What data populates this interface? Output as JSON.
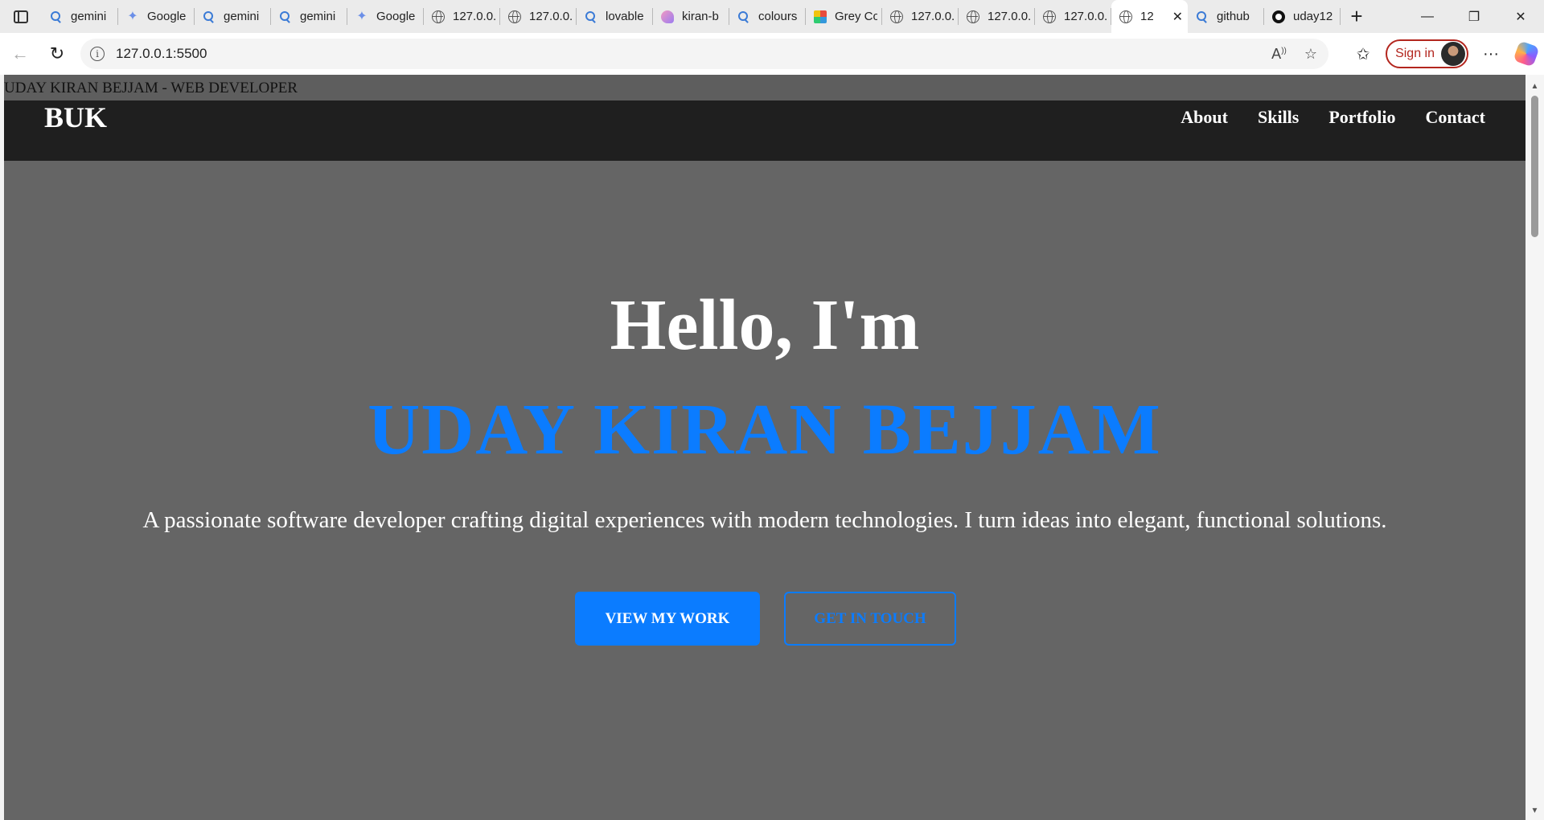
{
  "browser": {
    "tabs": [
      {
        "icon": "search-icon",
        "title": "gemini"
      },
      {
        "icon": "gemini-spark-icon",
        "title": "Google"
      },
      {
        "icon": "search-icon",
        "title": "gemini"
      },
      {
        "icon": "search-icon",
        "title": "gemini"
      },
      {
        "icon": "gemini-spark-icon",
        "title": "Google"
      },
      {
        "icon": "globe-icon",
        "title": "127.0.0."
      },
      {
        "icon": "globe-icon",
        "title": "127.0.0."
      },
      {
        "icon": "search-icon",
        "title": "lovable"
      },
      {
        "icon": "lovable-icon",
        "title": "kiran-b"
      },
      {
        "icon": "search-icon",
        "title": "colours"
      },
      {
        "icon": "color-grid-icon",
        "title": "Grey Co"
      },
      {
        "icon": "globe-icon",
        "title": "127.0.0."
      },
      {
        "icon": "globe-icon",
        "title": "127.0.0."
      },
      {
        "icon": "globe-icon",
        "title": "127.0.0."
      },
      {
        "icon": "globe-icon",
        "title": "12",
        "active": true
      },
      {
        "icon": "search-icon",
        "title": "github"
      },
      {
        "icon": "github-icon",
        "title": "uday12"
      }
    ],
    "new_tab_label": "+",
    "address": "127.0.0.1:5500",
    "sign_in_label": "Sign in"
  },
  "page": {
    "top_text": "UDAY KIRAN BEJJAM - WEB DEVELOPER",
    "logo": "BUK",
    "nav": [
      "About",
      "Skills",
      "Portfolio",
      "Contact"
    ],
    "hero": {
      "greeting": "Hello, I'm",
      "name": "UDAY KIRAN BEJJAM",
      "tagline": "A passionate software developer crafting digital experiences with modern technologies. I turn ideas into elegant, functional solutions.",
      "primary_button": "VIEW MY WORK",
      "secondary_button": "GET IN TOUCH"
    }
  },
  "colors": {
    "accent": "#0b7cff",
    "nav_bg": "#1f1f1f",
    "hero_bg": "#656565"
  }
}
